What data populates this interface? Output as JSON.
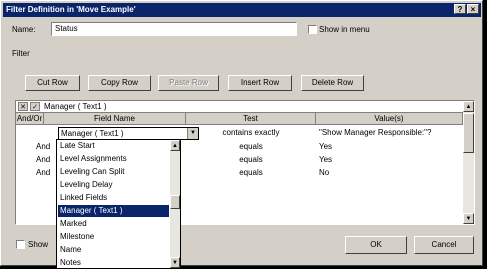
{
  "window": {
    "title": "Filter Definition in 'Move Example'",
    "help_glyph": "?",
    "close_glyph": "×"
  },
  "name_field": {
    "label": "Name:",
    "value": "Status"
  },
  "show_in_menu": {
    "label": "Show in menu",
    "checked": false
  },
  "filter_label": "Filter",
  "toolbar": {
    "cut_row": "Cut Row",
    "copy_row": "Copy Row",
    "paste_row": "Paste Row",
    "insert_row": "Insert Row",
    "delete_row": "Delete Row"
  },
  "edit_bar": {
    "cancel_glyph": "✕",
    "accept_glyph": "✓",
    "value": "Manager ( Text1 )"
  },
  "grid": {
    "columns": [
      "And/Or",
      "Field Name",
      "Test",
      "Value(s)"
    ],
    "rows": [
      {
        "andor": "",
        "field": "Manager ( Text1 )",
        "test": "contains exactly",
        "value": "\"Show Manager Responsible:\"?"
      },
      {
        "andor": "And",
        "field": "",
        "test": "equals",
        "value": "Yes"
      },
      {
        "andor": "And",
        "field": "",
        "test": "equals",
        "value": "Yes"
      },
      {
        "andor": "And",
        "field": "",
        "test": "equals",
        "value": "No"
      }
    ]
  },
  "dropdown": {
    "items": [
      "Late Start",
      "Level Assignments",
      "Leveling Can Split",
      "Leveling Delay",
      "Linked Fields",
      "Manager ( Text1 )",
      "Marked",
      "Milestone",
      "Name",
      "Notes"
    ],
    "selected": "Manager ( Text1 )"
  },
  "show_related": {
    "label": "Show",
    "checked": false
  },
  "buttons": {
    "ok": "OK",
    "cancel": "Cancel"
  }
}
